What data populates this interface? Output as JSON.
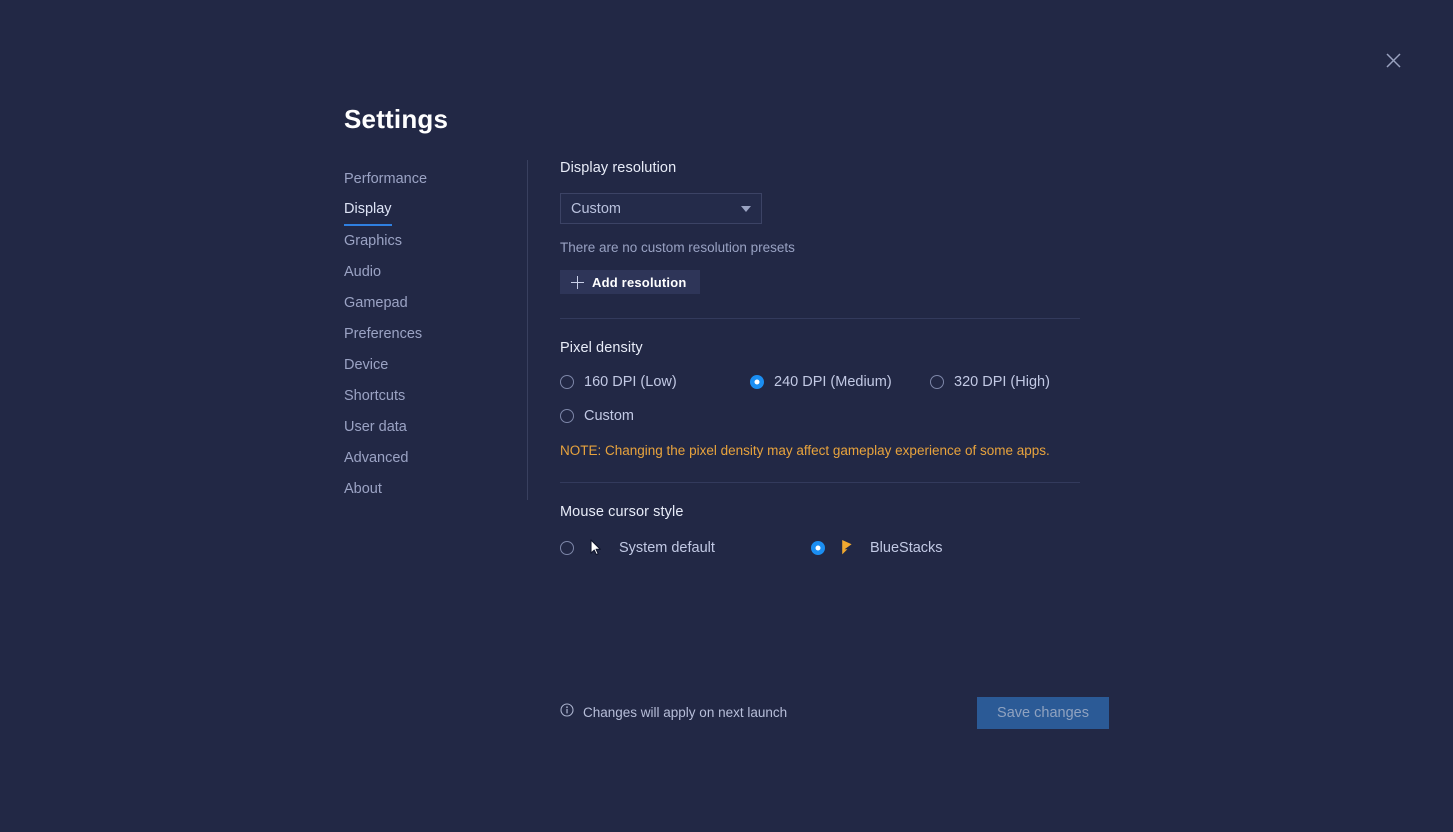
{
  "window": {
    "title": "Settings",
    "close_icon": "close-icon"
  },
  "sidebar": {
    "items": [
      {
        "label": "Performance",
        "active": false
      },
      {
        "label": "Display",
        "active": true
      },
      {
        "label": "Graphics",
        "active": false
      },
      {
        "label": "Audio",
        "active": false
      },
      {
        "label": "Gamepad",
        "active": false
      },
      {
        "label": "Preferences",
        "active": false
      },
      {
        "label": "Device",
        "active": false
      },
      {
        "label": "Shortcuts",
        "active": false
      },
      {
        "label": "User data",
        "active": false
      },
      {
        "label": "Advanced",
        "active": false
      },
      {
        "label": "About",
        "active": false
      }
    ]
  },
  "display_resolution": {
    "heading": "Display resolution",
    "selected": "Custom",
    "options": [
      "Custom"
    ],
    "empty_hint": "There are no custom resolution presets",
    "add_button": "Add resolution"
  },
  "pixel_density": {
    "heading": "Pixel density",
    "options": [
      {
        "label": "160 DPI (Low)",
        "selected": false
      },
      {
        "label": "240 DPI (Medium)",
        "selected": true
      },
      {
        "label": "320 DPI (High)",
        "selected": false
      },
      {
        "label": "Custom",
        "selected": false
      }
    ],
    "note": "NOTE: Changing the pixel density may affect gameplay experience of some apps."
  },
  "mouse_cursor_style": {
    "heading": "Mouse cursor style",
    "options": [
      {
        "label": "System default",
        "selected": false,
        "icon": "system-cursor-icon"
      },
      {
        "label": "BlueStacks",
        "selected": true,
        "icon": "bluestacks-cursor-icon"
      }
    ]
  },
  "footer": {
    "info_icon": "info-icon",
    "note": "Changes will apply on next launch",
    "save_label": "Save changes",
    "save_enabled": false
  },
  "colors": {
    "background": "#222845",
    "accent_blue": "#1b8ef2",
    "note_orange": "#e8a33d",
    "cursor_orange": "#f0a830",
    "save_button": "#2b5a96"
  }
}
